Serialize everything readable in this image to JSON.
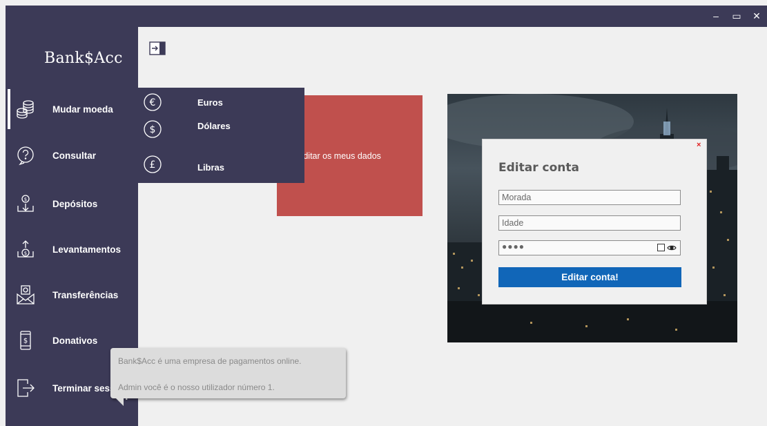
{
  "window": {
    "minimize_glyph": "‒",
    "maximize_glyph": "▭",
    "close_glyph": "✕"
  },
  "sidebar": {
    "brand": "Bank$Acc",
    "items": [
      {
        "label": "Mudar moeda",
        "icon": "coins-stack-icon"
      },
      {
        "label": "Consultar",
        "icon": "question-circle-icon"
      },
      {
        "label": "Depósitos",
        "icon": "deposit-icon"
      },
      {
        "label": "Levantamentos",
        "icon": "withdrawal-icon"
      },
      {
        "label": "Transferências",
        "icon": "money-envelope-icon"
      },
      {
        "label": "Donativos",
        "icon": "phone-dollar-icon"
      },
      {
        "label": "Terminar sessão",
        "icon": "logout-icon"
      }
    ],
    "help": "?"
  },
  "currency_menu": {
    "items": [
      {
        "label": "Euros",
        "icon": "euro-icon"
      },
      {
        "label": "Dólares",
        "icon": "dollar-icon"
      },
      {
        "label": "Libras",
        "icon": "pound-icon"
      }
    ]
  },
  "tile": {
    "label": "Editar os meus dados",
    "color": "#c0504d"
  },
  "dialog": {
    "close": "×",
    "title": "Editar conta",
    "address_value": "Morada",
    "age_value": "Idade",
    "password_mask": "●●●●",
    "submit": "Editar conta!"
  },
  "tooltip": {
    "line1": "Bank$Acc é uma empresa de pagamentos online.",
    "line2": "Admin você é o nosso utilizador número 1."
  },
  "colors": {
    "sidebar_bg": "#3c3a57",
    "accent_button": "#1166b8",
    "close_red": "#e02020"
  }
}
